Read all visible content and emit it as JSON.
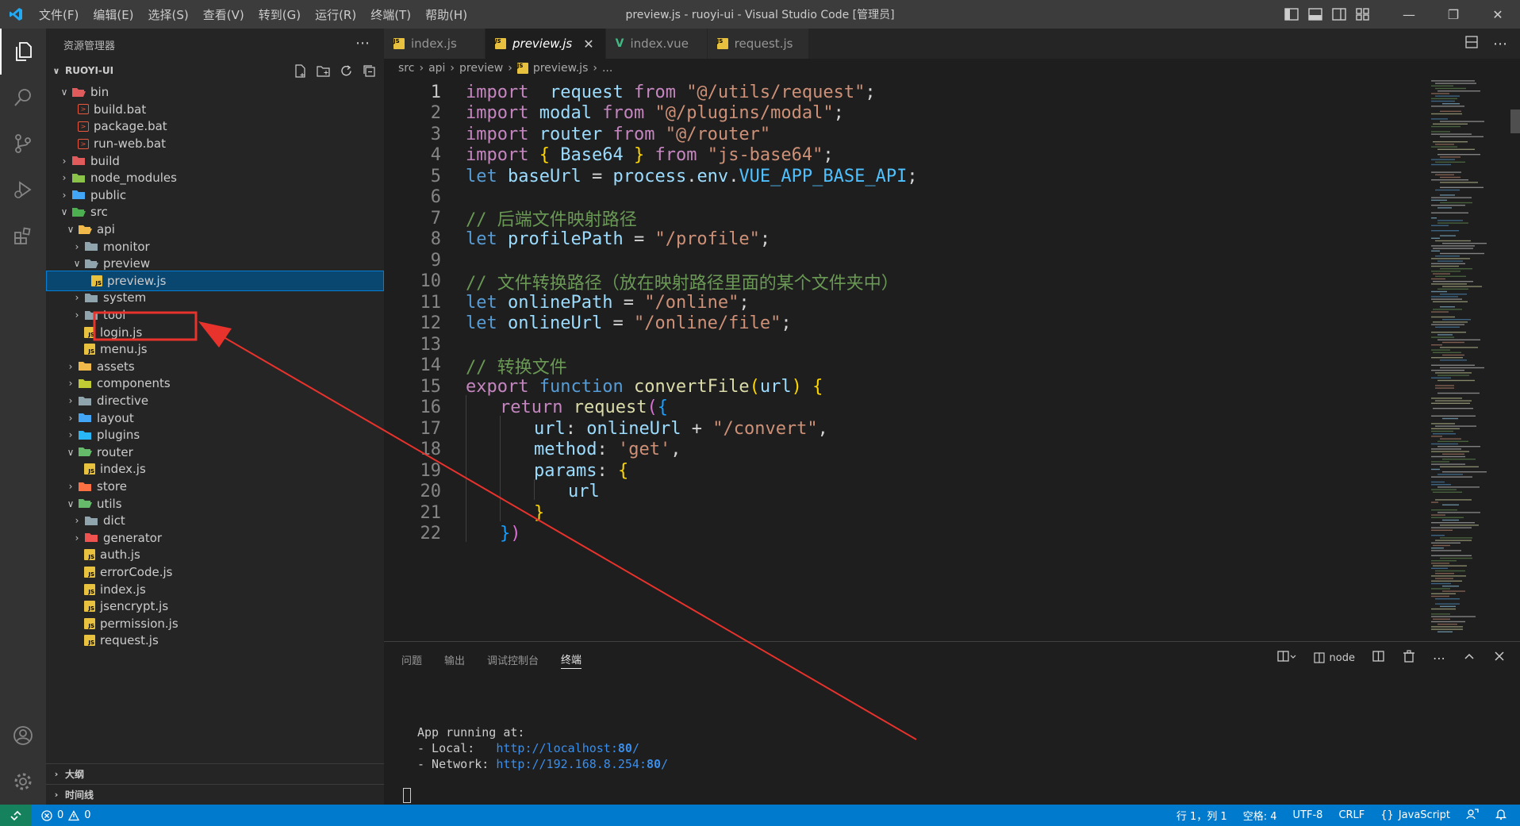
{
  "titlebar": {
    "menu": [
      "文件(F)",
      "编辑(E)",
      "选择(S)",
      "查看(V)",
      "转到(G)",
      "运行(R)",
      "终端(T)",
      "帮助(H)"
    ],
    "title": "preview.js - ruoyi-ui - Visual Studio Code [管理员]"
  },
  "sidebar": {
    "header": "资源管理器",
    "project": "RUOYI-UI",
    "sections": [
      "大纲",
      "时间线"
    ],
    "tree": [
      {
        "label": "bin",
        "depth": 1,
        "kind": "folder",
        "expanded": true,
        "color": "#e05c5c"
      },
      {
        "label": "build.bat",
        "depth": 2,
        "kind": "bat"
      },
      {
        "label": "package.bat",
        "depth": 2,
        "kind": "bat"
      },
      {
        "label": "run-web.bat",
        "depth": 2,
        "kind": "bat"
      },
      {
        "label": "build",
        "depth": 1,
        "kind": "folder",
        "expanded": false,
        "color": "#e05c5c"
      },
      {
        "label": "node_modules",
        "depth": 1,
        "kind": "folder",
        "expanded": false,
        "color": "#8bc34a"
      },
      {
        "label": "public",
        "depth": 1,
        "kind": "folder",
        "expanded": false,
        "color": "#42a5f5"
      },
      {
        "label": "src",
        "depth": 1,
        "kind": "folder",
        "expanded": true,
        "color": "#4caf50"
      },
      {
        "label": "api",
        "depth": 2,
        "kind": "folder",
        "expanded": true,
        "color": "#f0b94a"
      },
      {
        "label": "monitor",
        "depth": 3,
        "kind": "folder",
        "expanded": false,
        "color": "#90a4ae"
      },
      {
        "label": "preview",
        "depth": 3,
        "kind": "folder",
        "expanded": true,
        "color": "#90a4ae"
      },
      {
        "label": "preview.js",
        "depth": 4,
        "kind": "js",
        "selected": true
      },
      {
        "label": "system",
        "depth": 3,
        "kind": "folder",
        "expanded": false,
        "color": "#90a4ae"
      },
      {
        "label": "tool",
        "depth": 3,
        "kind": "folder",
        "expanded": false,
        "color": "#90a4ae"
      },
      {
        "label": "login.js",
        "depth": 3,
        "kind": "js"
      },
      {
        "label": "menu.js",
        "depth": 3,
        "kind": "js"
      },
      {
        "label": "assets",
        "depth": 2,
        "kind": "folder",
        "expanded": false,
        "color": "#f0b94a"
      },
      {
        "label": "components",
        "depth": 2,
        "kind": "folder",
        "expanded": false,
        "color": "#c0ca33"
      },
      {
        "label": "directive",
        "depth": 2,
        "kind": "folder",
        "expanded": false,
        "color": "#90a4ae"
      },
      {
        "label": "layout",
        "depth": 2,
        "kind": "folder",
        "expanded": false,
        "color": "#42a5f5"
      },
      {
        "label": "plugins",
        "depth": 2,
        "kind": "folder",
        "expanded": false,
        "color": "#29b6f6"
      },
      {
        "label": "router",
        "depth": 2,
        "kind": "folder",
        "expanded": true,
        "color": "#66bb6a"
      },
      {
        "label": "index.js",
        "depth": 3,
        "kind": "js"
      },
      {
        "label": "store",
        "depth": 2,
        "kind": "folder",
        "expanded": false,
        "color": "#ff7043"
      },
      {
        "label": "utils",
        "depth": 2,
        "kind": "folder",
        "expanded": true,
        "color": "#66bb6a"
      },
      {
        "label": "dict",
        "depth": 3,
        "kind": "folder",
        "expanded": false,
        "color": "#90a4ae"
      },
      {
        "label": "generator",
        "depth": 3,
        "kind": "folder",
        "expanded": false,
        "color": "#ef5350"
      },
      {
        "label": "auth.js",
        "depth": 3,
        "kind": "js"
      },
      {
        "label": "errorCode.js",
        "depth": 3,
        "kind": "js"
      },
      {
        "label": "index.js",
        "depth": 3,
        "kind": "js"
      },
      {
        "label": "jsencrypt.js",
        "depth": 3,
        "kind": "js"
      },
      {
        "label": "permission.js",
        "depth": 3,
        "kind": "js"
      },
      {
        "label": "request.js",
        "depth": 3,
        "kind": "js"
      }
    ]
  },
  "editor": {
    "tabs": [
      {
        "label": "index.js",
        "kind": "js",
        "active": false
      },
      {
        "label": "preview.js",
        "kind": "js",
        "active": true
      },
      {
        "label": "index.vue",
        "kind": "vue",
        "active": false
      },
      {
        "label": "request.js",
        "kind": "js",
        "active": false
      }
    ],
    "breadcrumb": [
      "src",
      "api",
      "preview",
      "preview.js",
      "..."
    ],
    "lines": [
      [
        [
          "k",
          "import"
        ],
        [
          "",
          "  "
        ],
        [
          "v",
          "request"
        ],
        [
          "",
          " "
        ],
        [
          "k",
          "from"
        ],
        [
          "",
          " "
        ],
        [
          "s",
          "\"@/utils/request\""
        ],
        [
          "",
          ";"
        ]
      ],
      [
        [
          "k",
          "import"
        ],
        [
          "",
          " "
        ],
        [
          "v",
          "modal"
        ],
        [
          "",
          " "
        ],
        [
          "k",
          "from"
        ],
        [
          "",
          " "
        ],
        [
          "s",
          "\"@/plugins/modal\""
        ],
        [
          "",
          ";"
        ]
      ],
      [
        [
          "k",
          "import"
        ],
        [
          "",
          " "
        ],
        [
          "v",
          "router"
        ],
        [
          "",
          " "
        ],
        [
          "k",
          "from"
        ],
        [
          "",
          " "
        ],
        [
          "s",
          "\"@/router\""
        ]
      ],
      [
        [
          "k",
          "import"
        ],
        [
          "",
          " "
        ],
        [
          "p1",
          "{"
        ],
        [
          "",
          " "
        ],
        [
          "v",
          "Base64"
        ],
        [
          "",
          " "
        ],
        [
          "p1",
          "}"
        ],
        [
          "",
          " "
        ],
        [
          "k",
          "from"
        ],
        [
          "",
          " "
        ],
        [
          "s",
          "\"js-base64\""
        ],
        [
          "",
          ";"
        ]
      ],
      [
        [
          "b",
          "let"
        ],
        [
          "",
          " "
        ],
        [
          "v",
          "baseUrl"
        ],
        [
          "",
          " = "
        ],
        [
          "v",
          "process"
        ],
        [
          "",
          "."
        ],
        [
          "v",
          "env"
        ],
        [
          "",
          "."
        ],
        [
          "cst",
          "VUE_APP_BASE_API"
        ],
        [
          "",
          ";"
        ]
      ],
      [],
      [
        [
          "c",
          "// 后端文件映射路径"
        ]
      ],
      [
        [
          "b",
          "let"
        ],
        [
          "",
          " "
        ],
        [
          "v",
          "profilePath"
        ],
        [
          "",
          " = "
        ],
        [
          "s",
          "\"/profile\""
        ],
        [
          "",
          ";"
        ]
      ],
      [],
      [
        [
          "c",
          "// 文件转换路径（放在映射路径里面的某个文件夹中）"
        ]
      ],
      [
        [
          "b",
          "let"
        ],
        [
          "",
          " "
        ],
        [
          "v",
          "onlinePath"
        ],
        [
          "",
          " = "
        ],
        [
          "s",
          "\"/online\""
        ],
        [
          "",
          ";"
        ]
      ],
      [
        [
          "b",
          "let"
        ],
        [
          "",
          " "
        ],
        [
          "v",
          "onlineUrl"
        ],
        [
          "",
          " = "
        ],
        [
          "s",
          "\"/online/file\""
        ],
        [
          "",
          ";"
        ]
      ],
      [],
      [
        [
          "c",
          "// 转换文件"
        ]
      ],
      [
        [
          "k",
          "export"
        ],
        [
          "",
          " "
        ],
        [
          "b",
          "function"
        ],
        [
          "",
          " "
        ],
        [
          "f",
          "convertFile"
        ],
        [
          "p1",
          "("
        ],
        [
          "v",
          "url"
        ],
        [
          "p1",
          ")"
        ],
        [
          "",
          " "
        ],
        [
          "p1",
          "{"
        ]
      ],
      [
        [
          "",
          ""
        ],
        [
          "k",
          "return"
        ],
        [
          "",
          " "
        ],
        [
          "f",
          "request"
        ],
        [
          "p2",
          "("
        ],
        [
          "p3",
          "{"
        ]
      ],
      [
        [
          "v",
          "url"
        ],
        [
          "",
          ": "
        ],
        [
          "v",
          "onlineUrl"
        ],
        [
          "",
          " + "
        ],
        [
          "s",
          "\"/convert\""
        ],
        [
          "",
          ","
        ]
      ],
      [
        [
          "v",
          "method"
        ],
        [
          "",
          ": "
        ],
        [
          "s",
          "'get'"
        ],
        [
          "",
          ","
        ]
      ],
      [
        [
          "v",
          "params"
        ],
        [
          "",
          ": "
        ],
        [
          "p1",
          "{"
        ]
      ],
      [
        [
          "v",
          "url"
        ]
      ],
      [
        [
          "p1",
          "}"
        ]
      ],
      [
        [
          "p3",
          "}"
        ],
        [
          "p2",
          ")"
        ]
      ]
    ],
    "indents": [
      0,
      0,
      0,
      0,
      0,
      0,
      0,
      0,
      0,
      0,
      0,
      0,
      0,
      0,
      0,
      1,
      2,
      2,
      2,
      3,
      2,
      1
    ]
  },
  "panel": {
    "tabs": [
      "问题",
      "输出",
      "调试控制台",
      "终端"
    ],
    "active_tab": "终端",
    "terminal_name": "node",
    "terminal": {
      "line1": "App running at:",
      "local_label": "- Local:   ",
      "local_url": "http://localhost:",
      "local_port": "80",
      "local_tail": "/",
      "network_label": "- Network: ",
      "network_url": "http://192.168.8.254:",
      "network_port": "80",
      "network_tail": "/"
    }
  },
  "statusbar": {
    "errors": "0",
    "warnings": "0",
    "position": "行 1，列 1",
    "spaces": "空格: 4",
    "encoding": "UTF-8",
    "eol": "CRLF",
    "language": "JavaScript"
  },
  "colors": {
    "accent": "#007acc",
    "annotation": "#e8322c"
  }
}
